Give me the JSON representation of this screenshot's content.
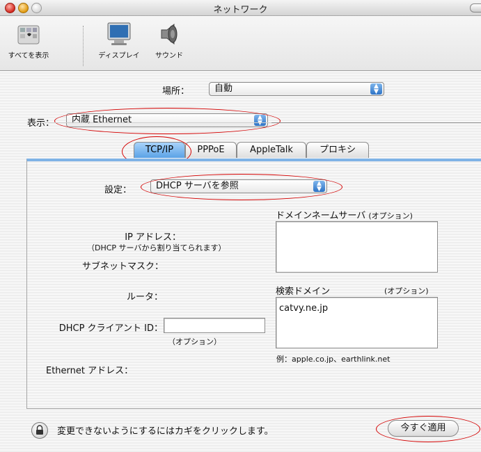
{
  "window": {
    "title": "ネットワーク"
  },
  "toolbar": {
    "items": [
      {
        "label": "すべてを表示",
        "icon": "show-all-icon"
      },
      {
        "label": "ディスプレイ",
        "icon": "display-icon"
      },
      {
        "label": "サウンド",
        "icon": "speaker-icon"
      }
    ]
  },
  "location": {
    "label": "場所：",
    "value": "自動"
  },
  "show": {
    "label": "表示：",
    "value": "内蔵 Ethernet"
  },
  "tabs": [
    "TCP/IP",
    "PPPoE",
    "AppleTalk",
    "プロキシ"
  ],
  "active_tab": "TCP/IP",
  "tcpip": {
    "configure_label": "設定：",
    "configure_value": "DHCP サーバを参照",
    "ip_label": "IP アドレス：",
    "ip_note": "（DHCP サーバから割り当てられます）",
    "subnet_label": "サブネットマスク：",
    "router_label": "ルータ：",
    "dhcp_client_label": "DHCP クライアント ID：",
    "dhcp_client_value": "",
    "dhcp_client_note": "（オプション）",
    "ethernet_label": "Ethernet アドレス：",
    "dns_label": "ドメインネームサーバ",
    "dns_option": "(オプション)",
    "dns_value": "",
    "search_label": "検索ドメイン",
    "search_option": "(オプション)",
    "search_value": "catvy.ne.jp",
    "example": "例：apple.co.jp、earthlink.net"
  },
  "footer": {
    "lock_text": "変更できないようにするにはカギをクリックします。",
    "apply_label": "今すぐ適用"
  },
  "colors": {
    "annotation": "#d40000",
    "accent": "#3b86d6"
  }
}
